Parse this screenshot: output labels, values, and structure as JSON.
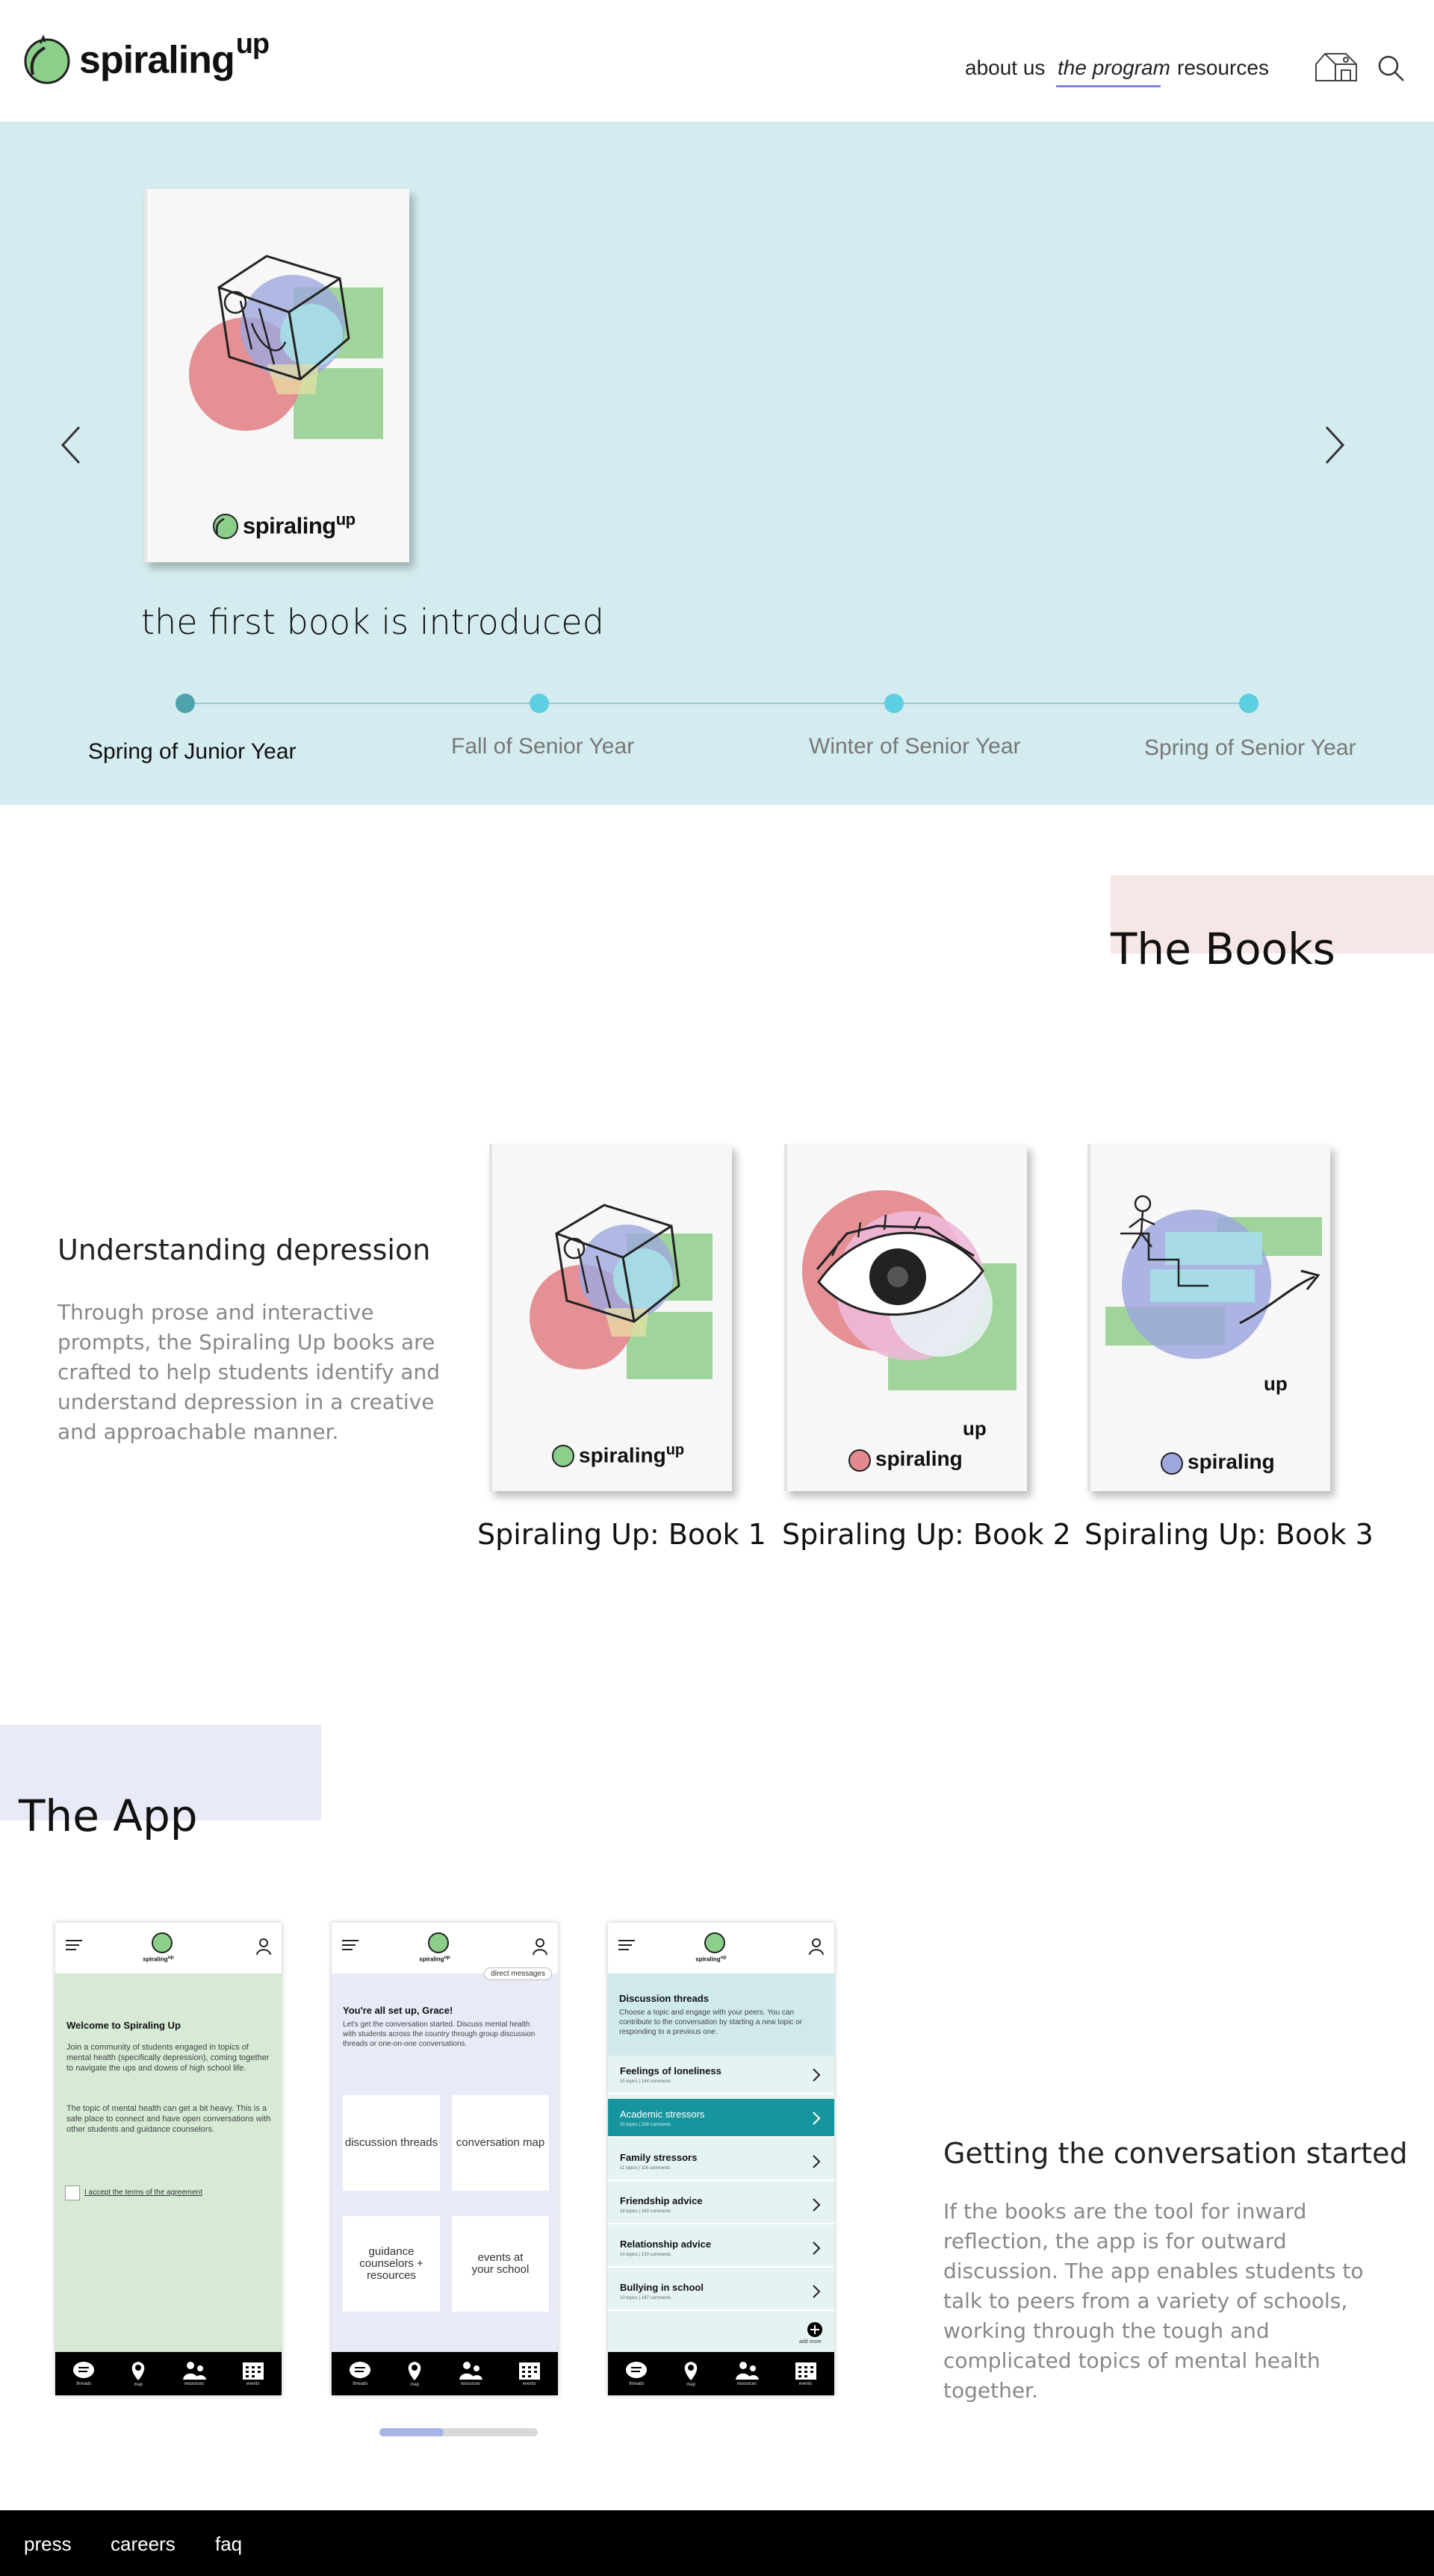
{
  "header": {
    "logo_text": "spiraling",
    "logo_sup": "up",
    "nav": [
      {
        "label": "about us",
        "active": false
      },
      {
        "label": "the program",
        "active": true
      },
      {
        "label": "resources",
        "active": false
      }
    ],
    "icons": [
      "house-icon",
      "search-icon"
    ]
  },
  "hero": {
    "caption": "the first book is introduced",
    "book_logo_text": "spiraling",
    "book_logo_sup": "up",
    "timeline": [
      {
        "label": "Spring of Junior Year",
        "active": true
      },
      {
        "label": "Fall of Senior Year",
        "active": false
      },
      {
        "label": "Winter of Senior Year",
        "active": false
      },
      {
        "label": "Spring of Senior Year",
        "active": false
      }
    ],
    "colors": {
      "background": "#d4ecef",
      "active_dot": "#4fa3ad",
      "dot": "#5ccfe0"
    }
  },
  "books": {
    "title": "The Books",
    "heading": "Understanding depression",
    "body": "Through prose and interactive prompts, the Spiraling Up books are crafted to help students identify and understand depression in a creative and approachable manner.",
    "items": [
      {
        "label": "Spiraling Up: Book 1",
        "logo_text": "spiraling",
        "logo_sup": "up"
      },
      {
        "label": "Spiraling Up: Book 2",
        "logo_text": "spiraling",
        "logo_sup": "up"
      },
      {
        "label": "Spiraling Up: Book 3",
        "logo_text": "spiraling",
        "logo_sup": "up"
      }
    ]
  },
  "app": {
    "title": "The App",
    "heading": "Getting the conversation started",
    "body": "If the books are the tool for inward reflection, the app is for outward discussion. The app enables students to talk to peers from a variety of schools, working through the tough and complicated topics of mental health together.",
    "phone_logo_text": "spiraling",
    "phone_logo_sup": "up",
    "tabs": [
      "threads",
      "map",
      "resources",
      "events"
    ],
    "screen1": {
      "title": "Welcome to Spiraling Up",
      "p1": "Join a community of students engaged in topics of mental health (specifically depression), coming together to navigate the ups and downs of high school life.",
      "p2": "The topic of mental health can get a bit heavy. This is a safe place to connect and have open conversations with other students and guidance counselors.",
      "checkbox_label": "I accept the terms of the agreement"
    },
    "screen2": {
      "dm_label": "direct messages",
      "title": "You're all set up, Grace!",
      "body": "Let's get the conversation started. Discuss mental health with students across the country through group discussion threads or one-on-one conversations.",
      "tiles": [
        "discussion threads",
        "conversation map",
        "guidance counselors + resources",
        "events at your school"
      ]
    },
    "screen3": {
      "title": "Discussion threads",
      "body": "Choose a topic and engage with your peers. You can contribute to the conversation by starting a new topic or responding to a previous one.",
      "threads": [
        {
          "title": "Feelings of loneliness",
          "meta": "15 topics | 144 comments",
          "active": false
        },
        {
          "title": "Academic stressors",
          "meta": "20 topics | 208 comments",
          "active": true
        },
        {
          "title": "Family stressors",
          "meta": "11 topics | 116 comments",
          "active": false
        },
        {
          "title": "Friendship advice",
          "meta": "18 topics | 160 comments",
          "active": false
        },
        {
          "title": "Relationship advice",
          "meta": "14 topics | 130 comments",
          "active": false
        },
        {
          "title": "Bullying in school",
          "meta": "10 topics | 187 comments",
          "active": false
        }
      ],
      "add_label": "add more"
    },
    "carousel_position": 0.4
  },
  "footer": {
    "links": [
      "press",
      "careers",
      "faq"
    ]
  }
}
